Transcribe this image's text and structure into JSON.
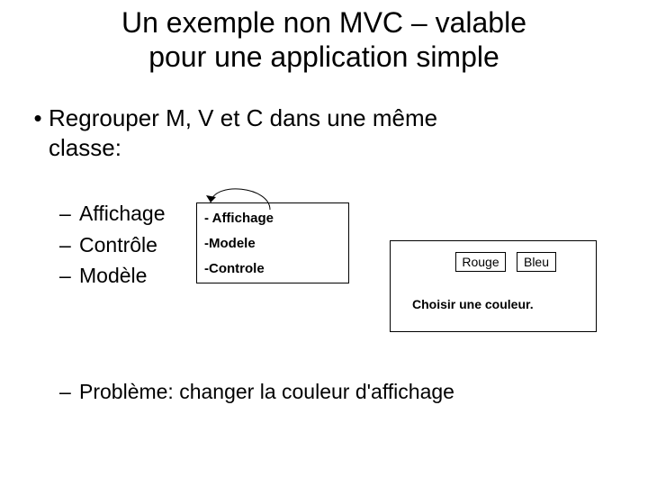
{
  "title_line1": "Un exemple non MVC – valable",
  "title_line2": "pour une application simple",
  "bullet1_line1": "Regrouper M, V et C dans une même",
  "bullet1_line2": "classe:",
  "sub": {
    "a": "Affichage",
    "b": "Contrôle",
    "c": "Modèle"
  },
  "box1": {
    "l1": "- Affichage",
    "l2": "-Modele",
    "l3": "-Controle"
  },
  "box2": {
    "btn1": "Rouge",
    "btn2": "Bleu",
    "caption": "Choisir une couleur."
  },
  "bullet2": "Problème: changer la couleur d'affichage"
}
